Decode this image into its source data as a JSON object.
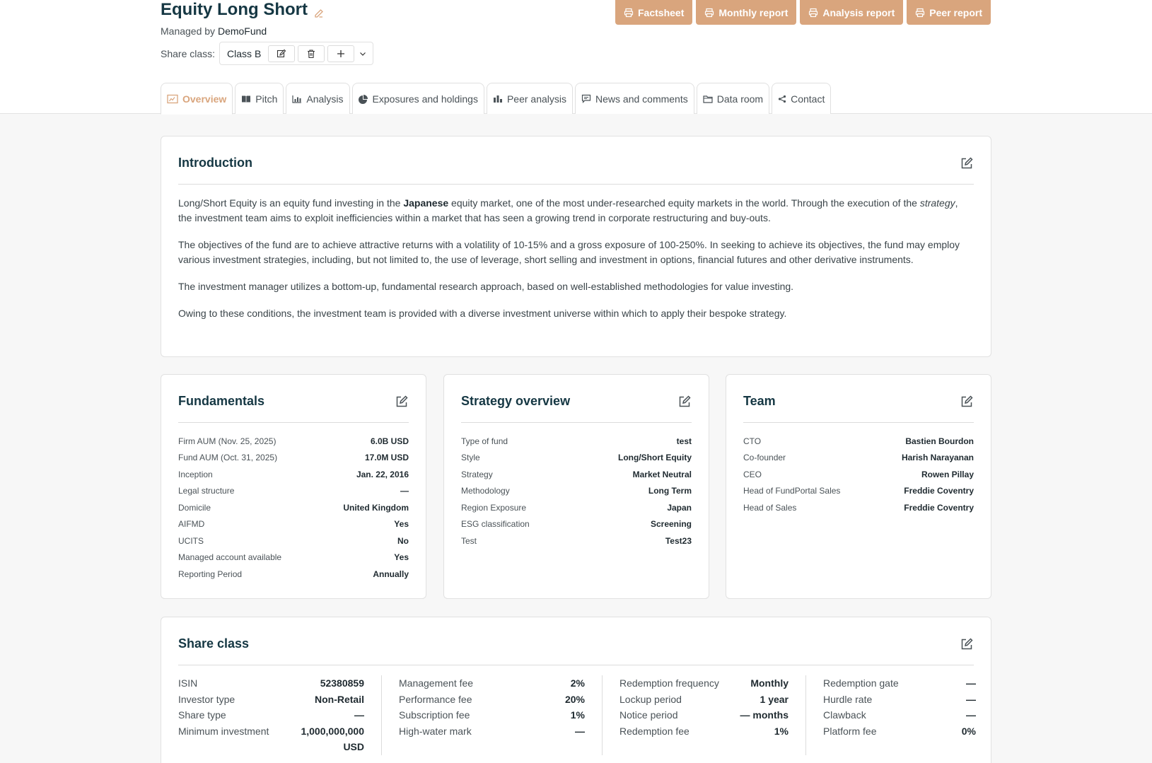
{
  "header": {
    "title": "Equity Long Short",
    "managed_prefix": "Managed by",
    "manager": "DemoFund",
    "share_class_label": "Share class:",
    "share_class_value": "Class B"
  },
  "report_buttons": [
    "Factsheet",
    "Monthly report",
    "Analysis report",
    "Peer report"
  ],
  "tabs": [
    {
      "label": "Overview",
      "icon": "overview-icon"
    },
    {
      "label": "Pitch",
      "icon": "book-icon"
    },
    {
      "label": "Analysis",
      "icon": "chart-icon"
    },
    {
      "label": "Exposures and holdings",
      "icon": "pie-icon"
    },
    {
      "label": "Peer analysis",
      "icon": "bar-icon"
    },
    {
      "label": "News and comments",
      "icon": "comment-icon"
    },
    {
      "label": "Data room",
      "icon": "folder-icon"
    },
    {
      "label": "Contact",
      "icon": "share-icon"
    }
  ],
  "intro": {
    "title": "Introduction",
    "p1_a": "Long/Short Equity is an equity fund investing in the ",
    "p1_b": "Japanese",
    "p1_c": " equity market, one of the most under-researched equity markets in the world. Through the execution of the ",
    "p1_d": "strategy",
    "p1_e": ", the investment team aims to exploit inefficiencies within a market that has seen a growing trend in corporate restructuring and buy-outs.",
    "p2": "The objectives of the fund are to achieve attractive returns with a volatility of 10-15% and a gross exposure of 100-250%. In seeking to achieve its objectives, the fund may employ various investment strategies, including, but not limited to, the use of leverage, short selling and investment in options, financial futures and other derivative instruments.",
    "p3": "The investment manager utilizes a bottom-up, fundamental research approach, based on well-established methodologies for value investing.",
    "p4": "Owing to these conditions, the investment team is provided with a diverse investment universe within which to apply their bespoke strategy."
  },
  "fundamentals": {
    "title": "Fundamentals",
    "rows": [
      [
        "Firm AUM (Nov. 25, 2025)",
        "6.0B USD"
      ],
      [
        "Fund AUM (Oct. 31, 2025)",
        "17.0M USD"
      ],
      [
        "Inception",
        "Jan. 22, 2016"
      ],
      [
        "Legal structure",
        "—"
      ],
      [
        "Domicile",
        "United Kingdom"
      ],
      [
        "AIFMD",
        "Yes"
      ],
      [
        "UCITS",
        "No"
      ],
      [
        "Managed account available",
        "Yes"
      ],
      [
        "Reporting Period",
        "Annually"
      ]
    ]
  },
  "strategy": {
    "title": "Strategy overview",
    "rows": [
      [
        "Type of fund",
        "test"
      ],
      [
        "Style",
        "Long/Short Equity"
      ],
      [
        "Strategy",
        "Market Neutral"
      ],
      [
        "Methodology",
        "Long Term"
      ],
      [
        "Region Exposure",
        "Japan"
      ],
      [
        "ESG classification",
        "Screening"
      ],
      [
        "Test",
        "Test23"
      ]
    ]
  },
  "team": {
    "title": "Team",
    "rows": [
      [
        "CTO",
        "Bastien Bourdon"
      ],
      [
        "Co-founder",
        "Harish Narayanan"
      ],
      [
        "CEO",
        "Rowen Pillay"
      ],
      [
        "Head of FundPortal Sales",
        "Freddie Coventry"
      ],
      [
        "Head of Sales",
        "Freddie Coventry"
      ]
    ]
  },
  "share_class": {
    "title": "Share class",
    "col1": [
      [
        "ISIN",
        "52380859"
      ],
      [
        "Investor type",
        "Non-Retail"
      ],
      [
        "Share type",
        "—"
      ],
      [
        "Minimum investment",
        "1,000,000,000 USD"
      ]
    ],
    "col2": [
      [
        "Management fee",
        "2%"
      ],
      [
        "Performance fee",
        "20%"
      ],
      [
        "Subscription fee",
        "1%"
      ],
      [
        "High-water mark",
        "—"
      ]
    ],
    "col3": [
      [
        "Redemption frequency",
        "Monthly"
      ],
      [
        "Lockup period",
        "1 year"
      ],
      [
        "Notice period",
        "— months"
      ],
      [
        "Redemption fee",
        "1%"
      ]
    ],
    "col4": [
      [
        "Redemption gate",
        "—"
      ],
      [
        "Hurdle rate",
        "—"
      ],
      [
        "Clawback",
        "—"
      ],
      [
        "Platform fee",
        "0%"
      ]
    ]
  },
  "colors": {
    "accent": "#d9a57d",
    "heading": "#153743",
    "border": "#e1e1e1",
    "background": "#f7f7f7"
  }
}
